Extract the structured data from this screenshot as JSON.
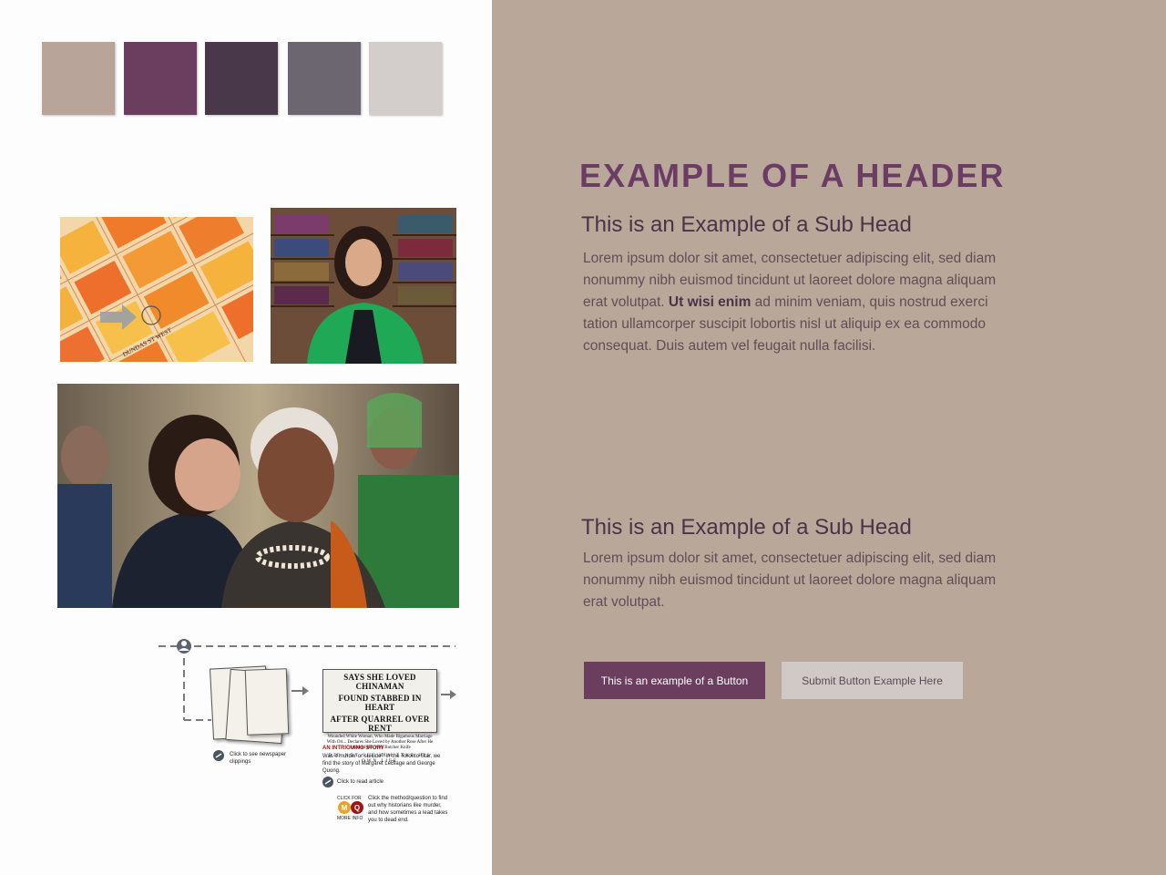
{
  "palette": [
    {
      "name": "taupe",
      "color": "#b8a498"
    },
    {
      "name": "plum",
      "color": "#6b3d5f"
    },
    {
      "name": "aubergine",
      "color": "#49374a"
    },
    {
      "name": "slate",
      "color": "#6b6670"
    },
    {
      "name": "light-grey",
      "color": "#d3cdcc"
    }
  ],
  "header": {
    "title": "EXAMPLE OF A HEADER"
  },
  "section1": {
    "subhead": "This is an Example of a Sub Head",
    "body_pre": "Lorem ipsum dolor sit amet, consectetuer adipiscing elit, sed diam nonummy nibh euismod tincidunt ut laoreet dolore magna aliquam erat volutpat. ",
    "body_bold": "Ut wisi enim",
    "body_post": " ad minim veniam, quis nostrud exerci tation ullamcorper suscipit lobortis nisl ut aliquip ex ea commodo consequat. Duis autem vel feugait nulla facilisi."
  },
  "section2": {
    "subhead": "This is an Example of a Sub Head",
    "body": "Lorem ipsum dolor sit amet, consectetuer adipiscing elit, sed diam nonummy nibh euismod tincidunt ut laoreet dolore magna aliquam erat volutpat."
  },
  "buttons": {
    "primary_label": "This is an example of a Button",
    "secondary_label": "Submit Button Example Here"
  },
  "diagram": {
    "clippings_caption": "Click to see newspaper clippings",
    "headline_line1": "SAYS SHE LOVED CHINAMAN",
    "headline_line2": "FOUND STABBED IN HEART",
    "headline_line3": "AFTER QUARREL OVER RENT",
    "headline_sub": "Wounded White Woman, Who Made Bigamous Marriage With Ori... Declares She Loved by Another Rose After He Attacked Her With Butcher Knife",
    "headline_deck": "DID NOT SEE HIM TAKE HIS OWN LIFE",
    "story_title": "AN INTRIGUING STORY",
    "story_text": "Was it murder or suicide? In the Toronto Star, we find the story of Margaret LeBlage and George Quong.",
    "read_article": "Click to read article",
    "click_for": "CLICK FOR",
    "more_info": "MORE INFO",
    "m_badge": "M",
    "q_badge": "Q",
    "method_text": "Click the method/question to find out why historians like murder, and how sometimes a lead takes you to dead end."
  },
  "images": {
    "map_alt": "Map with Dundas St West",
    "map_street_label": "DUNDAS ST WEST"
  }
}
